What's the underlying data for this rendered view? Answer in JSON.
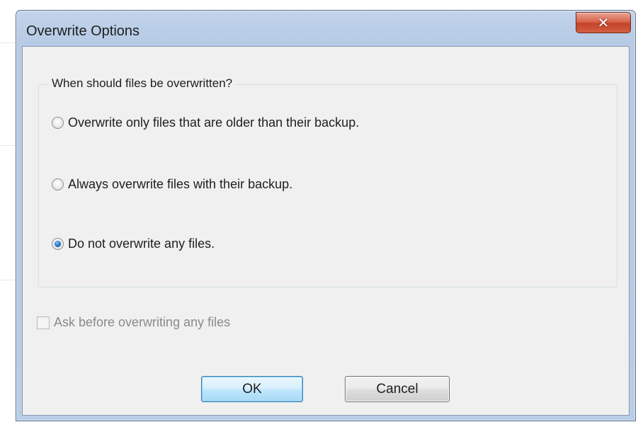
{
  "window": {
    "title": "Overwrite Options",
    "close_icon": "close-icon"
  },
  "group": {
    "legend": "When should files be overwritten?",
    "options": [
      {
        "label": "Overwrite only files that are older than their backup.",
        "checked": false
      },
      {
        "label": "Always overwrite files with their backup.",
        "checked": false
      },
      {
        "label": "Do not overwrite any files.",
        "checked": true
      }
    ]
  },
  "ask_checkbox": {
    "label": "Ask before overwriting any files",
    "checked": false,
    "enabled": false
  },
  "buttons": {
    "ok_label": "OK",
    "cancel_label": "Cancel"
  },
  "colors": {
    "close_button": "#c3432a",
    "ok_button_border": "#3c7fb1",
    "radio_selected": "#1e6fc2"
  }
}
